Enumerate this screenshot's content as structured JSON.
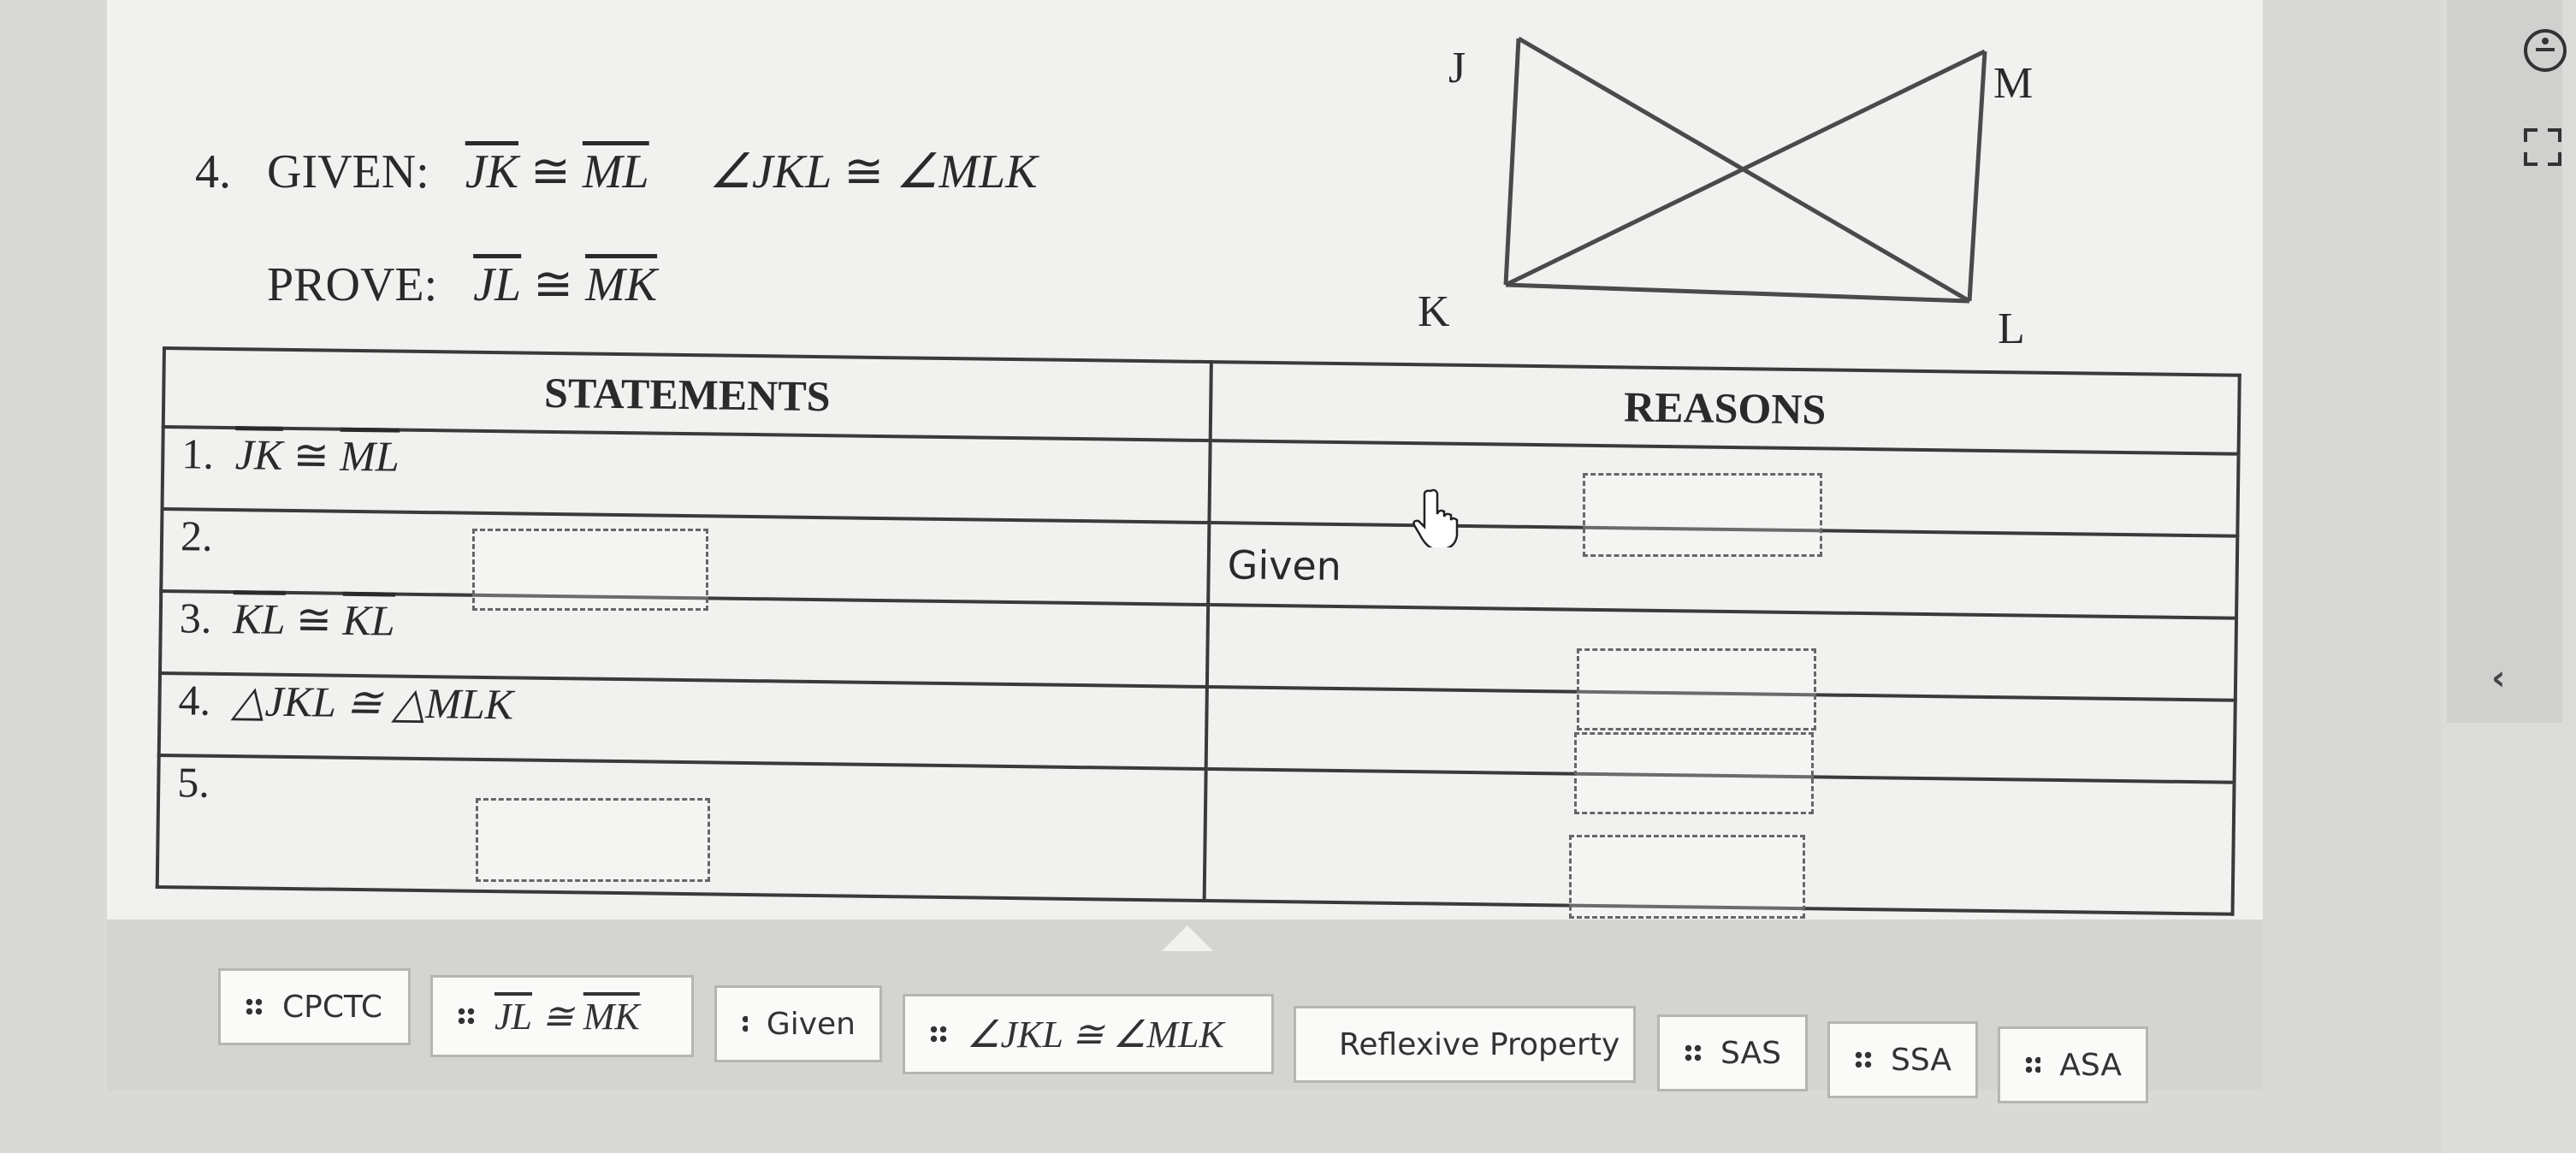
{
  "problem": {
    "number": "4.",
    "given_label": "GIVEN:",
    "given_seg1": "JK",
    "cong": "≅",
    "given_seg2": "ML",
    "given_angle1": "∠JKL",
    "given_angle2": "∠MLK",
    "prove_label": "PROVE:",
    "prove_seg1": "JL",
    "prove_seg2": "MK"
  },
  "figure": {
    "labels": {
      "J": "J",
      "M": "M",
      "K": "K",
      "L": "L"
    }
  },
  "table": {
    "statements_header": "STATEMENTS",
    "reasons_header": "REASONS",
    "rows": [
      {
        "num": "1.",
        "statement_a": "JK",
        "statement_b": "ML",
        "reason": ""
      },
      {
        "num": "2.",
        "statement": "",
        "reason": "Given"
      },
      {
        "num": "3.",
        "statement_a": "KL",
        "statement_b": "KL",
        "reason": ""
      },
      {
        "num": "4.",
        "statement": "△JKL ≅ △MLK",
        "reason": ""
      },
      {
        "num": "5.",
        "statement": "",
        "reason": ""
      }
    ]
  },
  "answer_bank": {
    "chips": [
      {
        "label": "CPCTC"
      },
      {
        "label_a": "JL",
        "label_b": "MK"
      },
      {
        "label": "Given"
      },
      {
        "label": "∠JKL ≅ ∠MLK"
      },
      {
        "label": "Reflexive Property"
      },
      {
        "label": "SAS"
      },
      {
        "label": "SSA"
      },
      {
        "label": "ASA"
      }
    ]
  },
  "colors": {
    "page_bg": "#f1f1ef",
    "tray_bg": "#d4d5d2",
    "chip_bg": "#fafaf8",
    "line": "#3a3a3a"
  },
  "icons": [
    "accessibility-icon",
    "fullscreen-icon",
    "chevron-left-icon",
    "drag-grip-icon",
    "hand-cursor-icon"
  ]
}
